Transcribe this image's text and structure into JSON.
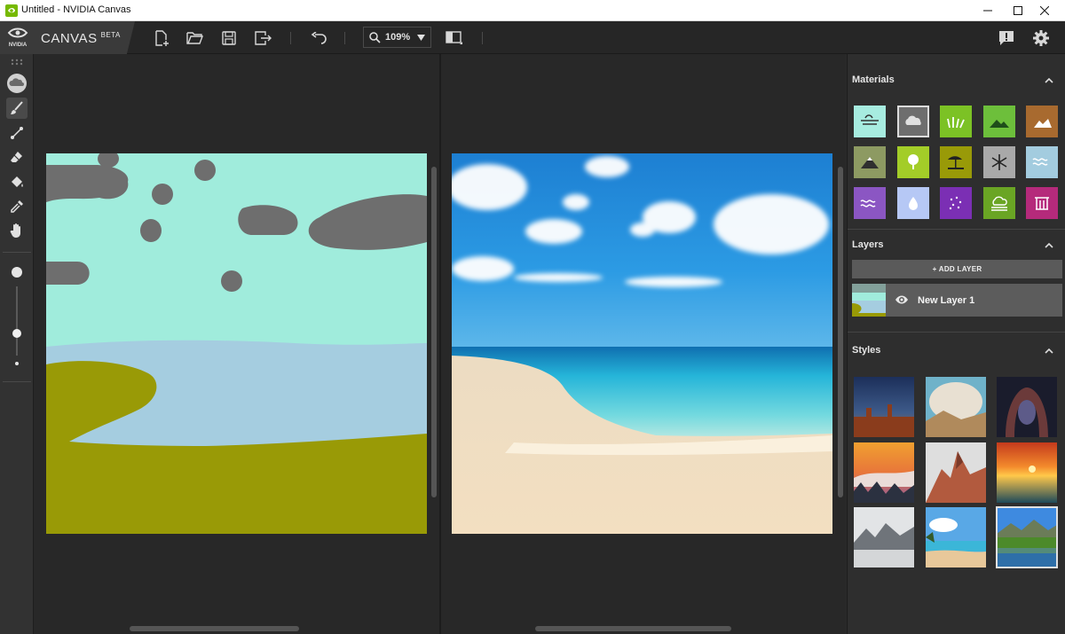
{
  "window": {
    "title": "Untitled - NVIDIA Canvas",
    "minimize_glyph": "minimize-icon",
    "maximize_glyph": "maximize-icon",
    "close_glyph": "close-icon"
  },
  "toolbar": {
    "brand_name": "CANVAS",
    "brand_badge": "BETA",
    "brand_logo_text": "NVIDIA",
    "zoom_value": "109%",
    "buttons": [
      "new-file-icon",
      "open-folder-icon",
      "save-icon",
      "export-icon",
      "undo-icon",
      "view-mode-icon",
      "feedback-icon",
      "settings-icon"
    ]
  },
  "tools": {
    "items": [
      "material-cloud",
      "brush",
      "line",
      "eraser",
      "fill",
      "eyedropper",
      "pan-hand"
    ],
    "brush_size_selected": "large"
  },
  "panel": {
    "materials_title": "Materials",
    "materials": [
      {
        "name": "sea",
        "color": "#a7ece0"
      },
      {
        "name": "cloud",
        "color": "#6e6e6e",
        "selected": true
      },
      {
        "name": "grass",
        "color": "#7cc225"
      },
      {
        "name": "hill",
        "color": "#6dbf3b"
      },
      {
        "name": "dirt",
        "color": "#a86a2f"
      },
      {
        "name": "mountain",
        "color": "#8d9a62"
      },
      {
        "name": "tree",
        "color": "#a3cd28"
      },
      {
        "name": "sand",
        "color": "#999a08"
      },
      {
        "name": "snow",
        "color": "#a9a9a9"
      },
      {
        "name": "water",
        "color": "#a3ccdf"
      },
      {
        "name": "river",
        "color": "#8b56c3"
      },
      {
        "name": "drop",
        "color": "#b6c8f5"
      },
      {
        "name": "flower",
        "color": "#7b2fb4"
      },
      {
        "name": "fog",
        "color": "#6aa524"
      },
      {
        "name": "building",
        "color": "#b52a7b"
      }
    ],
    "layers_title": "Layers",
    "add_layer_label": "+ ADD LAYER",
    "layer_name": "New Layer 1",
    "styles_title": "Styles",
    "styles_selected_index": 8
  }
}
